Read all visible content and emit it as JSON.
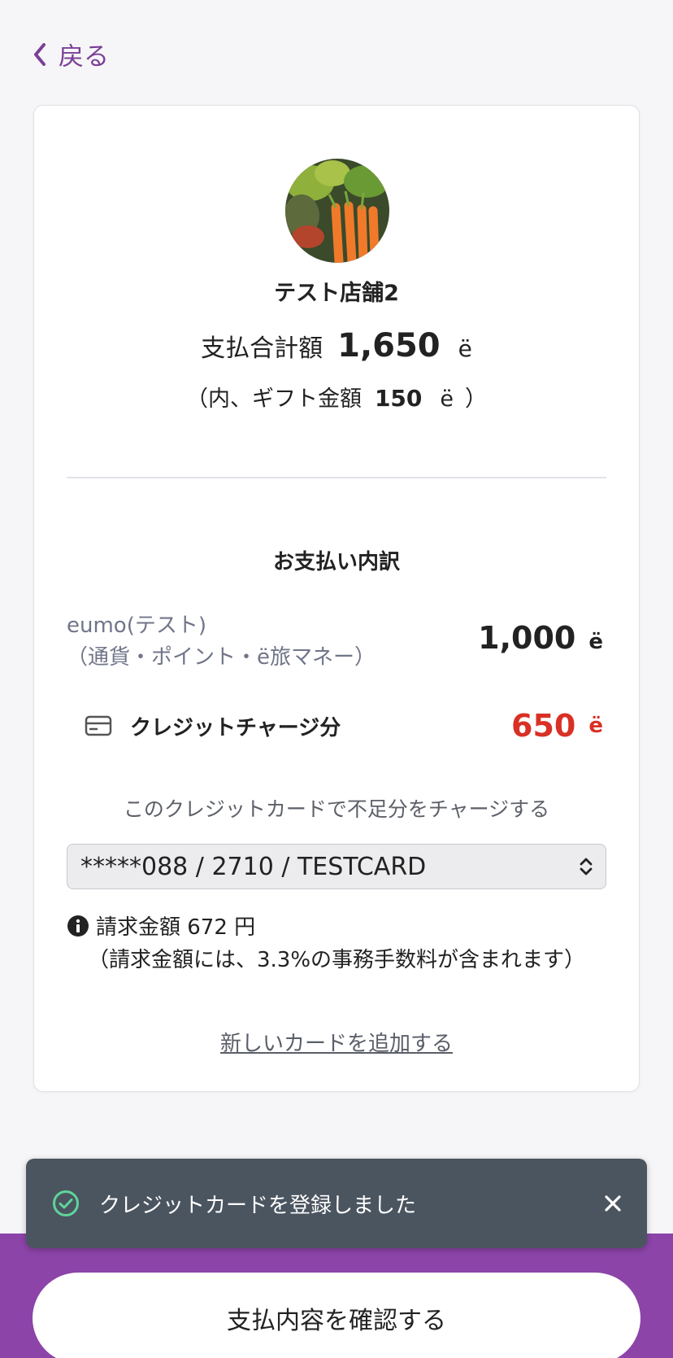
{
  "nav": {
    "back_label": "戻る"
  },
  "store": {
    "name": "テスト店舗2"
  },
  "summary": {
    "total_label": "支払合計額",
    "total_amount": "1,650",
    "currency_unit": "ë",
    "gift_prefix": "（内、ギフト金額",
    "gift_amount": "150",
    "gift_unit": "ë",
    "gift_suffix": "）"
  },
  "breakdown": {
    "title": "お支払い内訳",
    "eumo_label_line1": "eumo(テスト)",
    "eumo_label_line2": "（通貨・ポイント・ë旅マネー）",
    "eumo_amount": "1,000",
    "eumo_unit": "ë",
    "credit_label": "クレジットチャージ分",
    "credit_amount": "650",
    "credit_unit": "ë"
  },
  "charge": {
    "note": "このクレジットカードで不足分をチャージする",
    "selected_card": "*****088 / 2710 / TESTCARD",
    "billing_line": "請求金額 672 円",
    "fee_note": "（請求金額には、3.3%の事務手数料が含まれます）",
    "add_card_link": "新しいカードを追加する"
  },
  "toast": {
    "message": "クレジットカードを登録しました"
  },
  "footer": {
    "confirm_label": "支払内容を確認する"
  },
  "colors": {
    "accent": "#8c44a8",
    "back_link": "#7b3f96",
    "credit_red": "#d93025",
    "toast_bg": "#4b5560",
    "toast_check": "#5fd49a"
  },
  "icons": {
    "back": "chevron-left-icon",
    "card": "credit-card-icon",
    "select": "chevron-updown-icon",
    "info": "info-icon",
    "success": "check-circle-icon",
    "close": "close-icon"
  }
}
